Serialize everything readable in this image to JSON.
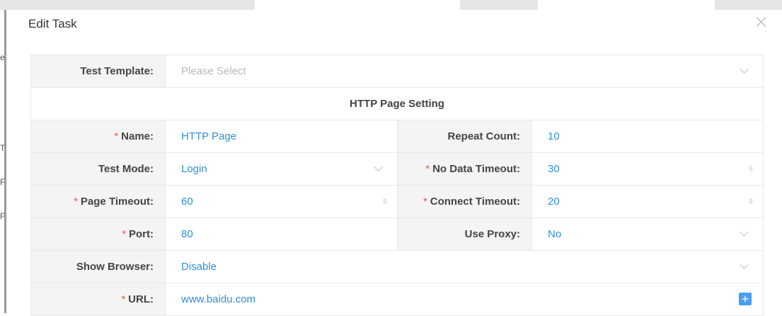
{
  "background": {
    "left_marks": [
      "e",
      "T",
      "F",
      "F"
    ]
  },
  "dialog": {
    "title": "Edit Task",
    "close_icon": "close-icon"
  },
  "form": {
    "template": {
      "label": "Test Template:",
      "placeholder": "Please Select"
    },
    "section_header": "HTTP Page Setting",
    "name": {
      "label": "Name:",
      "value": "HTTP Page"
    },
    "repeat_count": {
      "label": "Repeat Count:",
      "value": "10"
    },
    "test_mode": {
      "label": "Test Mode:",
      "value": "Login"
    },
    "no_data_timeout": {
      "label": "No Data Timeout:",
      "value": "30",
      "unit": "s"
    },
    "page_timeout": {
      "label": "Page Timeout:",
      "value": "60",
      "unit": "s"
    },
    "connect_timeout": {
      "label": "Connect Timeout:",
      "value": "20",
      "unit": "s"
    },
    "port": {
      "label": "Port:",
      "value": "80"
    },
    "use_proxy": {
      "label": "Use Proxy:",
      "value": "No"
    },
    "show_browser": {
      "label": "Show Browser:",
      "value": "Disable"
    },
    "url": {
      "label": "URL:",
      "value": "www.baidu.com",
      "add_symbol": "+"
    },
    "required_marker": "*"
  },
  "colors": {
    "value_text": "#2f8fd8",
    "required": "#ef5350",
    "label_bg": "#f4f4f4",
    "add_button": "#4a9ff5"
  }
}
